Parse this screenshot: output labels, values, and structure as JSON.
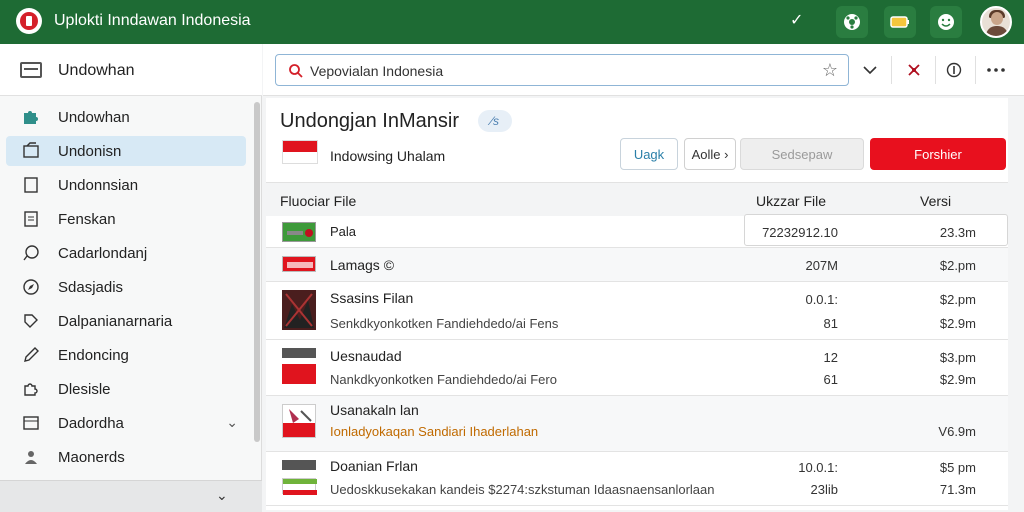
{
  "titlebar": {
    "title": "Uplokti Inndawan Indonesia",
    "check": "✓"
  },
  "sidebar": {
    "header": "Undowhan",
    "items": [
      {
        "label": "Undowhan",
        "icon": "puzzle-icon",
        "active": false
      },
      {
        "label": "Undonisn",
        "icon": "folder-icon",
        "active": true
      },
      {
        "label": "Undonnsian",
        "icon": "document-icon",
        "active": false
      },
      {
        "label": "Fenskan",
        "icon": "file-text-icon",
        "active": false
      },
      {
        "label": "Cadarlondanj",
        "icon": "chat-icon",
        "active": false
      },
      {
        "label": "Sdasjadis",
        "icon": "compass-icon",
        "active": false
      },
      {
        "label": "Dalpanianarnaria",
        "icon": "tag-icon",
        "active": false
      },
      {
        "label": "Endoncing",
        "icon": "pen-icon",
        "active": false
      },
      {
        "label": "Dlesisle",
        "icon": "puzzle-icon",
        "active": false
      },
      {
        "label": "Dadordha",
        "icon": "layout-icon",
        "active": false
      },
      {
        "label": "Maonerds",
        "icon": "people-icon",
        "active": false
      }
    ],
    "footer_chevron": "⌄"
  },
  "toolbar": {
    "search_value": "Vepovialan Indonesia"
  },
  "package": {
    "title": "Undongjan InMansir",
    "badge": "⁄s",
    "subtitle": "Indowsing Uhalam",
    "btn_uagk": "Uagk",
    "btn_aolle": "Aolle ›",
    "btn_sedsepaw": "Sedsepaw",
    "btn_forshier": "Forshier"
  },
  "table": {
    "headers": {
      "name": "Fluociar File",
      "size": "Ukzzar File",
      "version": "Versi"
    },
    "rows": [
      {
        "name": "Pala",
        "desc": "",
        "size": "72232912.10",
        "version": "23.3m"
      },
      {
        "name": "Lamags ©",
        "desc": "",
        "size": "207M",
        "version": "$2.pm"
      },
      {
        "name": "Ssasins Filan",
        "desc": "Senkdkyonkotken Fandiehdedo/ai Fens",
        "size": "0.0.1:",
        "size2": "81",
        "version": "$2.pm",
        "version2": "$2.9m"
      },
      {
        "name": "Uesnaudad",
        "desc": "Nankdkyonkotken Fandiehdedo/ai Fero",
        "size": "12",
        "size2": "61",
        "version": "$3.pm",
        "version2": "$2.9m"
      },
      {
        "name": "Usanakaln lan",
        "desc": "Ionladyokaqan Sandiari Ihaderlahan",
        "size": "",
        "version": "V6.9m"
      },
      {
        "name": "Doanian Frlan",
        "desc": "Uedoskkusekakan kandeis $2274:szkstuman Idaasnaensanlorlaan",
        "size": "10.0.1:",
        "size2": "23lib",
        "version": "$5 pm",
        "version2": "71.3m"
      }
    ]
  },
  "colors": {
    "titlebar": "#1e6b34",
    "primary": "#e8101e",
    "active_item": "#d7e9f5"
  }
}
